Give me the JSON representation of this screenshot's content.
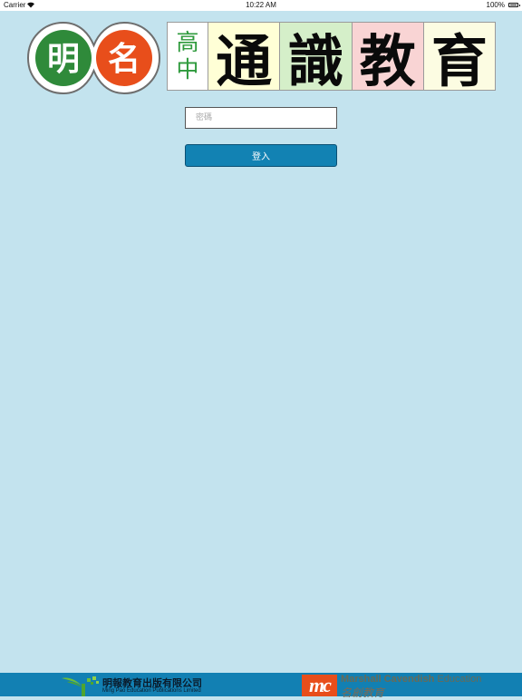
{
  "status_bar": {
    "carrier": "Carrier",
    "wifi_icon": "wifi-icon",
    "time": "10:22 AM",
    "battery_percent": "100%"
  },
  "header": {
    "logo_chars": [
      "明",
      "名"
    ],
    "logo_colors": {
      "left": "#2f8a3a",
      "right": "#e84e1b"
    },
    "banner_small": [
      "高",
      "中"
    ],
    "banner_big": [
      "通",
      "識",
      "教",
      "育"
    ],
    "banner_bg_colors": [
      "#ffffd6",
      "#d5efc9",
      "#f9d4d4",
      "#fcfce2"
    ]
  },
  "login": {
    "password_placeholder": "密碼",
    "password_value": "",
    "login_label": "登入"
  },
  "footer": {
    "mp_name_zh": "明報教育出版有限公司",
    "mp_name_en": "Ming Pao Education Publications Limited",
    "mc_mark": "mc",
    "mc_brand": "Marshall Cavendish",
    "mc_brand_suffix": "Education",
    "mc_name_zh": "名創教育"
  }
}
